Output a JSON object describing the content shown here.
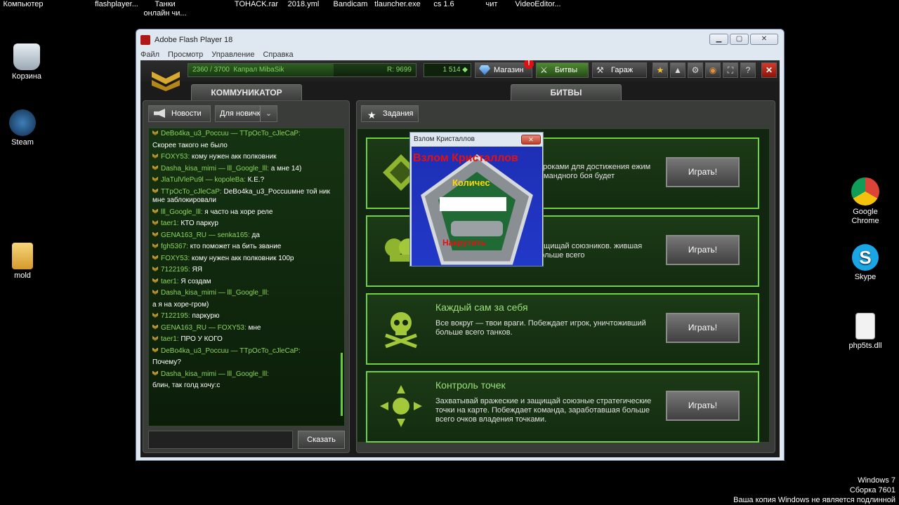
{
  "desktop": {
    "top_icons": [
      "Компьютер",
      "flashplayer...",
      "Танки онлайн чи...",
      "TOHACK.rar",
      "2018.yml",
      "Bandicam",
      "tlauncher.exe",
      "cs 1.6",
      "чит",
      "VideoEditor..."
    ],
    "left_icons": [
      "Корзина",
      "Steam",
      "mold"
    ],
    "right_icons": [
      "Google Chrome",
      "Skype",
      "php5ts.dll"
    ],
    "watermark": {
      "line1": "Windows 7",
      "line2": "Сборка 7601",
      "line3": "Ваша копия Windows не является подлинной"
    }
  },
  "window": {
    "title": "Adobe Flash Player 18",
    "menu": [
      "Файл",
      "Просмотр",
      "Управление",
      "Справка"
    ]
  },
  "topbar": {
    "xp": "2360 / 3700",
    "xp_progress": 0.638,
    "rank_name": "Капрал MibaSik",
    "rating": "R: 9699",
    "crystals": "1 514",
    "shop_label": "Магазин",
    "shop_badge": "!",
    "battles_label": "Битвы",
    "garage_label": "Гараж"
  },
  "left": {
    "tab": "КОММУНИКАТОР",
    "news_button": "Новости",
    "channel_select": "Для новичк",
    "say_button": "Сказать",
    "chat": [
      {
        "nick": "DeBo4ka_u3_Poccuu",
        "to": "TTpOcTo_cJleCaP:",
        "text": ""
      },
      {
        "nick": "",
        "to": "",
        "text": "Скорее такого не было"
      },
      {
        "nick": "FOXY53:",
        "to": "",
        "text": "кому нужен акк полковник"
      },
      {
        "nick": "Dasha_kisa_mimi",
        "to": "lll_Google_lll:",
        "text": "а мне 14)"
      },
      {
        "nick": "JlaTulVlePu9l",
        "to": "kopoleBa:",
        "text": "К.Е.?"
      },
      {
        "nick": "TTpOcTo_cJleCaP:",
        "to": "",
        "text": "DeBo4ka_u3_Poccuuмне той ник мне заблокировали"
      },
      {
        "nick": "lll_Google_lll:",
        "to": "",
        "text": "я часто на хоре реле"
      },
      {
        "nick": "taer1:",
        "to": "",
        "text": "КТО паркур"
      },
      {
        "nick": "GENA163_RU",
        "to": "senka165:",
        "text": "да"
      },
      {
        "nick": "fgh5367:",
        "to": "",
        "text": "кто поможет на бить звание"
      },
      {
        "nick": "FOXY53:",
        "to": "",
        "text": "кому нужен акк полковник 100р"
      },
      {
        "nick": "7122195:",
        "to": "",
        "text": "ЯЯ"
      },
      {
        "nick": "taer1:",
        "to": "",
        "text": "Я создам"
      },
      {
        "nick": "Dasha_kisa_mimi",
        "to": "lll_Google_lll:",
        "text": ""
      },
      {
        "nick": "",
        "to": "",
        "text": "а я на хоре-гром)"
      },
      {
        "nick": "7122195:",
        "to": "",
        "text": "паркурю"
      },
      {
        "nick": "GENA163_RU",
        "to": "FOXY53:",
        "text": "мне"
      },
      {
        "nick": "taer1:",
        "to": "",
        "text": "ПРО У КОГО"
      },
      {
        "nick": "DeBo4ka_u3_Poccuu",
        "to": "TTpOcTo_cJleCaP:",
        "text": ""
      },
      {
        "nick": "",
        "to": "",
        "text": "Почему?"
      },
      {
        "nick": "Dasha_kisa_mimi",
        "to": "lll_Google_lll:",
        "text": ""
      },
      {
        "nick": "",
        "to": "",
        "text": "блин, так голд хочу:с"
      }
    ]
  },
  "right": {
    "tab": "БИТВЫ",
    "tasks_button": "Задания",
    "modes": [
      {
        "title": "",
        "desc": "игроками для достижения ежим командного боя будет",
        "play": "Играть!"
      },
      {
        "title": "",
        "desc": "защищай союзников. жившая больше всего",
        "play": "Играть!"
      },
      {
        "title": "Каждый сам за себя",
        "desc": "Все вокруг — твои враги. Побеждает игрок, уничтоживший больше всего танков.",
        "play": "Играть!"
      },
      {
        "title": "Контроль точек",
        "desc": "Захватывай вражеские и защищай союзные стратегические точки на карте. Побеждает команда, заработавшая больше всего очков владения точками.",
        "play": "Играть!"
      }
    ]
  },
  "popup": {
    "title": "Взлом Кристаллов",
    "heading": "Взлом Кристаллов",
    "quantity": "Количес",
    "cheat": "Накрутить"
  },
  "colors": {
    "accent_green": "#6fd33f",
    "nick_green": "#8cd45c",
    "hack_red": "#e61010"
  }
}
